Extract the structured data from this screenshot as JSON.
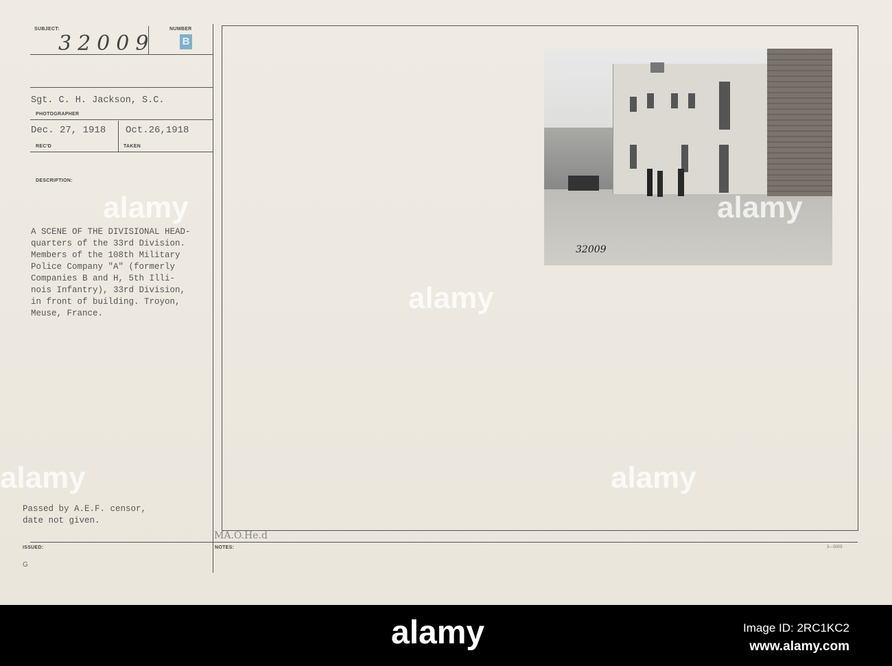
{
  "card": {
    "subject_label": "SUBJECT:",
    "subject_number": "32009",
    "number_label": "NUMBER",
    "number_stamp": "B",
    "photographer": "Sgt. C. H. Jackson, S.C.",
    "photographer_label": "PHOTOGRAPHER",
    "received": "Dec. 27, 1918",
    "received_label": "REC'D",
    "taken": "Oct.26,1918",
    "taken_label": "TAKEN",
    "description_label": "DESCRIPTION:",
    "description_lines": [
      "A SCENE OF THE DIVISIONAL HEAD-",
      "quarters of the 33rd Division.",
      "Members of the 108th Military",
      "Police Company \"A\" (formerly",
      "Companies B and H, 5th Illi-",
      "nois Infantry), 33rd Division,",
      "in front of building. Troyon,",
      "Meuse, France."
    ],
    "censor_lines": [
      "Passed by A.E.F. censor,",
      "date not given."
    ],
    "issued_label": "ISSUED:",
    "issued_mark": "G",
    "notes_label": "NOTES:",
    "handwritten_note": "MA.O.He.d",
    "form_number": "3—5005",
    "photo_number": "32009"
  },
  "watermark": "alamy",
  "footer": {
    "logo": "alamy",
    "image_id": "Image ID: 2RC1KC2",
    "url": "www.alamy.com"
  }
}
